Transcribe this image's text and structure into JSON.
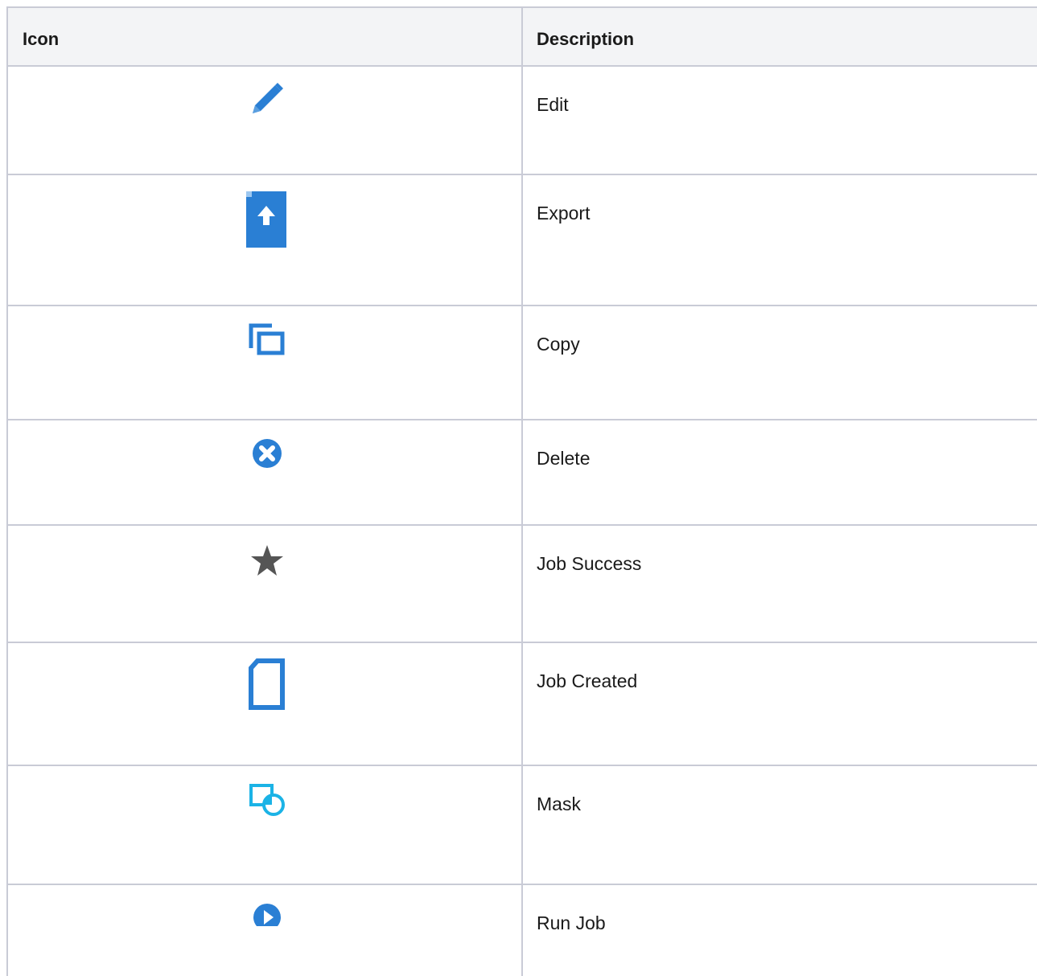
{
  "table": {
    "headers": {
      "icon": "Icon",
      "description": "Description"
    },
    "rows": [
      {
        "icon": "pencil-icon",
        "description": "Edit"
      },
      {
        "icon": "export-icon",
        "description": "Export"
      },
      {
        "icon": "copy-icon",
        "description": "Copy"
      },
      {
        "icon": "delete-icon",
        "description": "Delete"
      },
      {
        "icon": "star-icon",
        "description": "Job Success"
      },
      {
        "icon": "document-icon",
        "description": "Job Created"
      },
      {
        "icon": "mask-icon",
        "description": "Mask"
      },
      {
        "icon": "play-icon",
        "description": "Run Job"
      }
    ]
  },
  "colors": {
    "accent_blue": "#2a7fd4",
    "mask_teal": "#1bb3e6",
    "star_gray": "#555555",
    "border": "#c9cbd6",
    "header_bg": "#f3f4f6"
  }
}
